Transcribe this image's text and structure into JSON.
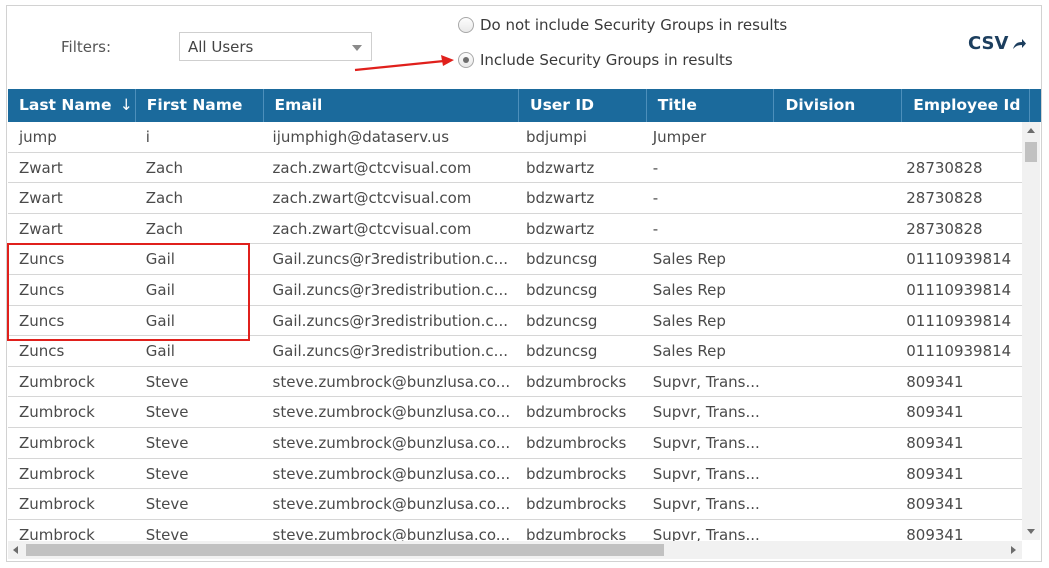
{
  "filters": {
    "label": "Filters:",
    "selected_option": "All Users"
  },
  "radio": {
    "exclude_label": "Do not include Security Groups in results",
    "include_label": "Include Security Groups in results",
    "selected": "include"
  },
  "csv": {
    "label": "CSV"
  },
  "annotation": {
    "color": "#e0201c"
  },
  "table": {
    "headers": [
      "Last Name",
      "First Name",
      "Email",
      "User ID",
      "Title",
      "Division",
      "Employee Id"
    ],
    "sort_indicator": "↓",
    "rows": [
      [
        "jump",
        "i",
        "ijumphigh@dataserv.us",
        "bdjumpi",
        "Jumper",
        "",
        ""
      ],
      [
        "Zwart",
        "Zach",
        "zach.zwart@ctcvisual.com",
        "bdzwartz",
        "-",
        "",
        "28730828"
      ],
      [
        "Zwart",
        "Zach",
        "zach.zwart@ctcvisual.com",
        "bdzwartz",
        "-",
        "",
        "28730828"
      ],
      [
        "Zwart",
        "Zach",
        "zach.zwart@ctcvisual.com",
        "bdzwartz",
        "-",
        "",
        "28730828"
      ],
      [
        "Zuncs",
        "Gail",
        "Gail.zuncs@r3redistribution.c...",
        "bdzuncsg",
        "Sales Rep",
        "",
        "01110939814"
      ],
      [
        "Zuncs",
        "Gail",
        "Gail.zuncs@r3redistribution.c...",
        "bdzuncsg",
        "Sales Rep",
        "",
        "01110939814"
      ],
      [
        "Zuncs",
        "Gail",
        "Gail.zuncs@r3redistribution.c...",
        "bdzuncsg",
        "Sales Rep",
        "",
        "01110939814"
      ],
      [
        "Zuncs",
        "Gail",
        "Gail.zuncs@r3redistribution.c...",
        "bdzuncsg",
        "Sales Rep",
        "",
        "01110939814"
      ],
      [
        "Zumbrock",
        "Steve",
        "steve.zumbrock@bunzlusa.co...",
        "bdzumbrocks",
        "Supvr, Trans...",
        "",
        "809341"
      ],
      [
        "Zumbrock",
        "Steve",
        "steve.zumbrock@bunzlusa.co...",
        "bdzumbrocks",
        "Supvr, Trans...",
        "",
        "809341"
      ],
      [
        "Zumbrock",
        "Steve",
        "steve.zumbrock@bunzlusa.co...",
        "bdzumbrocks",
        "Supvr, Trans...",
        "",
        "809341"
      ],
      [
        "Zumbrock",
        "Steve",
        "steve.zumbrock@bunzlusa.co...",
        "bdzumbrocks",
        "Supvr, Trans...",
        "",
        "809341"
      ],
      [
        "Zumbrock",
        "Steve",
        "steve.zumbrock@bunzlusa.co...",
        "bdzumbrocks",
        "Supvr, Trans...",
        "",
        "809341"
      ],
      [
        "Zumbrock",
        "Steve",
        "steve.zumbrock@bunzlusa.co...",
        "bdzumbrocks",
        "Supvr, Trans...",
        "",
        "809341"
      ]
    ]
  },
  "colors": {
    "header_bg": "#1b6a9c",
    "header_text": "#ffffff",
    "csv_text": "#1c3e5e"
  }
}
